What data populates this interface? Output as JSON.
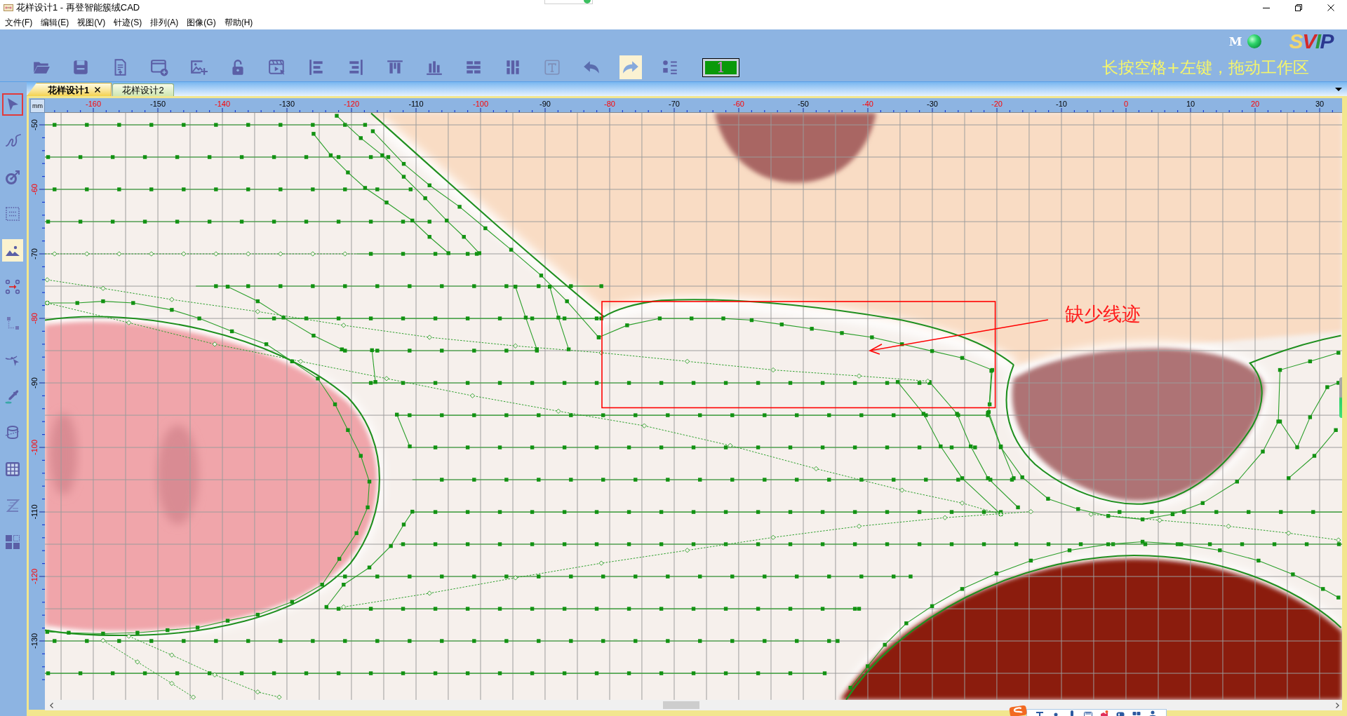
{
  "window": {
    "title": "花样设计1 - 再登智能簇绒CAD"
  },
  "menu": [
    "文件(F)",
    "编辑(E)",
    "视图(V)",
    "针迹(S)",
    "排列(A)",
    "图像(G)",
    "帮助(H)"
  ],
  "status": {
    "mode": "M"
  },
  "logo": [
    {
      "text": "S",
      "color": "#f3d66b"
    },
    {
      "text": "V",
      "color": "#d42a2a"
    },
    {
      "text": "I",
      "color": "#2e9a3e"
    },
    {
      "text": "P",
      "color": "#2b3990"
    }
  ],
  "toolbar": [
    {
      "kind": "open",
      "highlighted": false
    },
    {
      "kind": "save",
      "highlighted": false
    },
    {
      "kind": "export",
      "highlighted": false
    },
    {
      "kind": "window",
      "highlighted": false
    },
    {
      "kind": "picture",
      "highlighted": false
    },
    {
      "kind": "unlock",
      "highlighted": false
    },
    {
      "kind": "video",
      "highlighted": false
    },
    {
      "kind": "align_left",
      "highlighted": false
    },
    {
      "kind": "align_right",
      "highlighted": false
    },
    {
      "kind": "align_top",
      "highlighted": false
    },
    {
      "kind": "align_bottom",
      "highlighted": false
    },
    {
      "kind": "rows",
      "highlighted": false
    },
    {
      "kind": "columns",
      "highlighted": false
    },
    {
      "kind": "text",
      "highlighted": false
    },
    {
      "kind": "undo",
      "highlighted": false
    },
    {
      "kind": "redo",
      "highlighted": true
    },
    {
      "kind": "list",
      "highlighted": false
    }
  ],
  "layer_box": {
    "value": "1"
  },
  "hint": "长按空格+左键，拖动工作区",
  "tabs": [
    {
      "label": "花样设计1",
      "selected": true
    },
    {
      "label": "花样设计2",
      "selected": false
    }
  ],
  "tools": [
    {
      "kind": "select",
      "selected": true,
      "highlighted": false
    },
    {
      "kind": "curve",
      "selected": false,
      "highlighted": false
    },
    {
      "kind": "target",
      "selected": false,
      "highlighted": false
    },
    {
      "kind": "frame",
      "selected": false,
      "highlighted": false
    },
    {
      "kind": "image",
      "selected": false,
      "highlighted": true
    },
    {
      "kind": "nodes",
      "selected": false,
      "highlighted": false
    },
    {
      "kind": "connect",
      "selected": false,
      "highlighted": false
    },
    {
      "kind": "edit",
      "selected": false,
      "highlighted": false
    },
    {
      "kind": "eyedropper",
      "selected": false,
      "highlighted": false
    },
    {
      "kind": "cylinder",
      "selected": false,
      "highlighted": false
    },
    {
      "kind": "grid",
      "selected": false,
      "highlighted": false
    },
    {
      "kind": "zigzag",
      "selected": false,
      "highlighted": false
    },
    {
      "kind": "squares",
      "selected": false,
      "highlighted": false
    }
  ],
  "ruler": {
    "unit": "mm",
    "top": [
      {
        "text": "-160",
        "major": true
      },
      {
        "text": "-150",
        "major": false
      },
      {
        "text": "-140",
        "major": true
      },
      {
        "text": "-130",
        "major": false
      },
      {
        "text": "-120",
        "major": true
      },
      {
        "text": "-110",
        "major": false
      },
      {
        "text": "-100",
        "major": true
      },
      {
        "text": "-90",
        "major": false
      },
      {
        "text": "-80",
        "major": true
      },
      {
        "text": "-70",
        "major": false
      },
      {
        "text": "-60",
        "major": true
      },
      {
        "text": "-50",
        "major": false
      },
      {
        "text": "-40",
        "major": true
      },
      {
        "text": "-30",
        "major": false
      },
      {
        "text": "-20",
        "major": true
      },
      {
        "text": "-10",
        "major": false
      },
      {
        "text": "0",
        "major": true
      },
      {
        "text": "10",
        "major": false
      },
      {
        "text": "20",
        "major": true
      },
      {
        "text": "30",
        "major": false
      }
    ],
    "side": [
      {
        "text": "-50",
        "major": false
      },
      {
        "text": "-60",
        "major": true
      },
      {
        "text": "-70",
        "major": false
      },
      {
        "text": "-80",
        "major": true
      },
      {
        "text": "-90",
        "major": false
      },
      {
        "text": "-100",
        "major": true
      },
      {
        "text": "-110",
        "major": false
      },
      {
        "text": "-120",
        "major": true
      },
      {
        "text": "-130",
        "major": false
      }
    ]
  },
  "annotation": {
    "text": "缺少线迹"
  }
}
